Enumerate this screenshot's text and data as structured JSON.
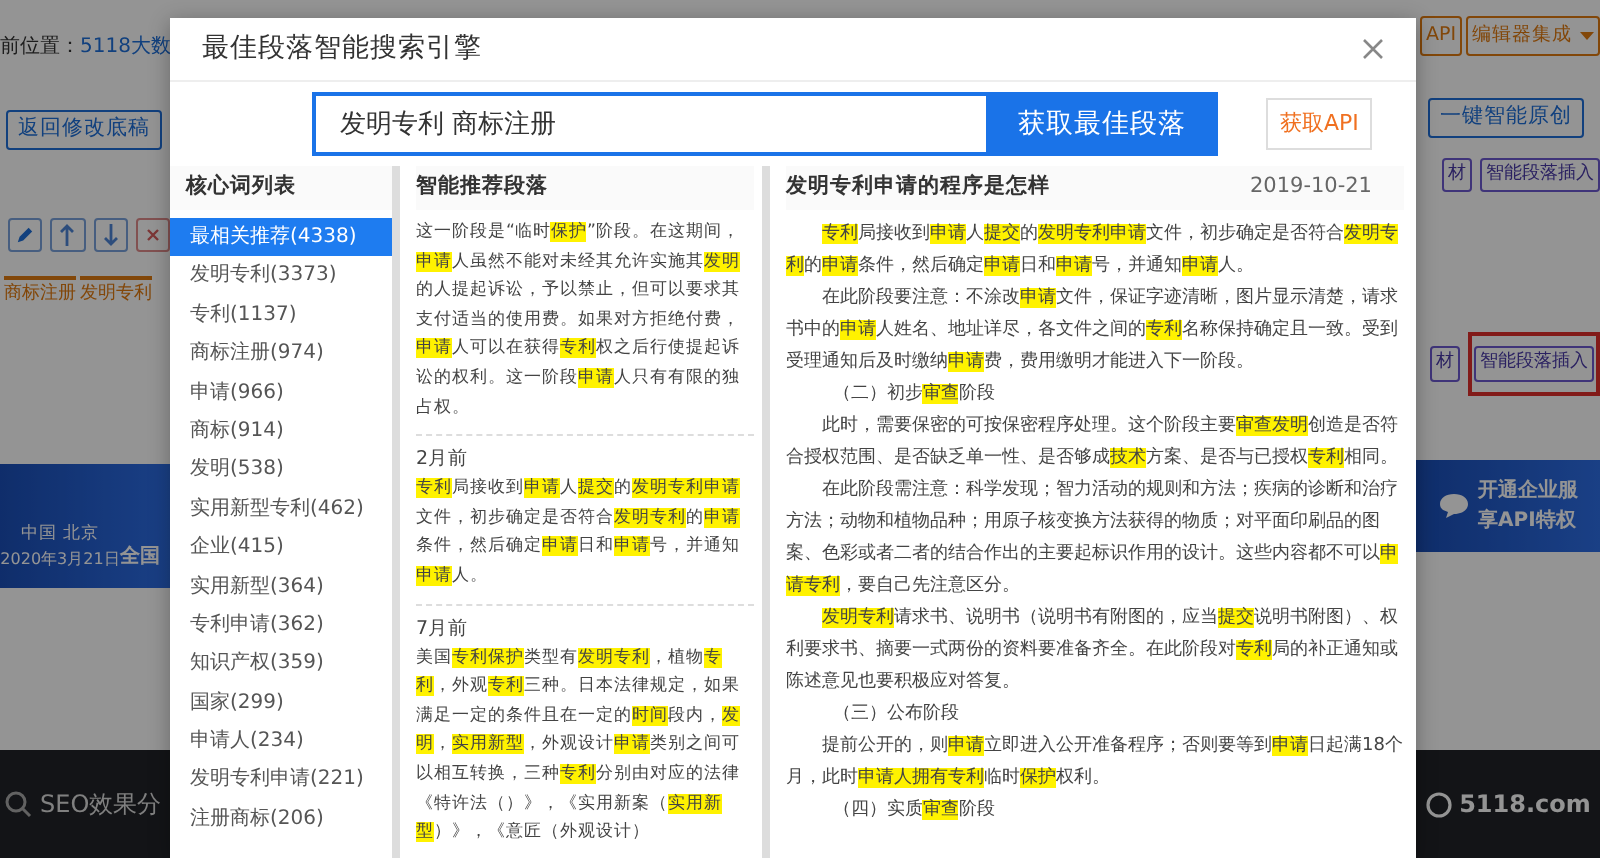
{
  "background": {
    "breadcrumb_label": "前位置：",
    "breadcrumb_link": "5118大数",
    "back_button": "返回修改底稿",
    "tags": [
      "商标注册",
      "发明专利"
    ],
    "banner": {
      "city": "中国 北京",
      "date": "2020年3月21日",
      "text_3": "全国"
    },
    "footer_search": "SEO效果分",
    "api_button": "API",
    "editor_menu": "编辑器集成",
    "rewrite_button": "一键智能原创",
    "toolbar_rows": [
      {
        "material": "材",
        "insert": "智能段落插入",
        "outlined": false
      },
      {
        "material": "材",
        "insert": "智能段落插入",
        "outlined": true
      }
    ],
    "promo": [
      "开通企业服",
      "享API特权"
    ],
    "logo": "5118.com"
  },
  "modal": {
    "title": "最佳段落智能搜索引擎",
    "search": {
      "value": "发明专利 商标注册",
      "button": "获取最佳段落"
    },
    "api_link": "获取API",
    "keywords": {
      "title": "核心词列表",
      "items": [
        {
          "label": "最相关推荐(4338)",
          "selected": true
        },
        {
          "label": "发明专利(3373)",
          "selected": false
        },
        {
          "label": "专利(1137)",
          "selected": false
        },
        {
          "label": "商标注册(974)",
          "selected": false
        },
        {
          "label": "申请(966)",
          "selected": false
        },
        {
          "label": "商标(914)",
          "selected": false
        },
        {
          "label": "发明(538)",
          "selected": false
        },
        {
          "label": "实用新型专利(462)",
          "selected": false
        },
        {
          "label": "企业(415)",
          "selected": false
        },
        {
          "label": "实用新型(364)",
          "selected": false
        },
        {
          "label": "专利申请(362)",
          "selected": false
        },
        {
          "label": "知识产权(359)",
          "selected": false
        },
        {
          "label": "国家(299)",
          "selected": false
        },
        {
          "label": "申请人(234)",
          "selected": false
        },
        {
          "label": "发明专利申请(221)",
          "selected": false
        },
        {
          "label": "注册商标(206)",
          "selected": false
        }
      ]
    },
    "recommended": {
      "title": "智能推荐段落",
      "blocks": [
        {
          "segments": [
            {
              "text": "这一阶段是“临时",
              "highlight": false
            },
            {
              "text": "保护",
              "highlight": true
            },
            {
              "text": "”阶段。在这期间，",
              "highlight": false
            },
            {
              "text": "申请",
              "highlight": true
            },
            {
              "text": "人虽然不能对未经其允许实施其",
              "highlight": false
            },
            {
              "text": "发明",
              "highlight": true
            },
            {
              "text": "的人提起诉讼，予以禁止，但可以要求其支付适当的使用费。如果对方拒绝付费，",
              "highlight": false
            },
            {
              "text": "申请",
              "highlight": true
            },
            {
              "text": "人可以在获得",
              "highlight": false
            },
            {
              "text": "专利",
              "highlight": true
            },
            {
              "text": "权之后行使提起诉讼的权利。这一阶段",
              "highlight": false
            },
            {
              "text": "申请",
              "highlight": true
            },
            {
              "text": "人只有有限的独占权。",
              "highlight": false
            }
          ]
        },
        {
          "age": "2月前",
          "segments": [
            {
              "text": "专利",
              "highlight": true
            },
            {
              "text": "局接收到",
              "highlight": false
            },
            {
              "text": "申请",
              "highlight": true
            },
            {
              "text": "人",
              "highlight": false
            },
            {
              "text": "提交",
              "highlight": true
            },
            {
              "text": "的",
              "highlight": false
            },
            {
              "text": "发明专利申请",
              "highlight": true
            },
            {
              "text": "文件，初步确定是否符合",
              "highlight": false
            },
            {
              "text": "发明专利",
              "highlight": true
            },
            {
              "text": "的",
              "highlight": false
            },
            {
              "text": "申请",
              "highlight": true
            },
            {
              "text": "条件，然后确定",
              "highlight": false
            },
            {
              "text": "申请",
              "highlight": true
            },
            {
              "text": "日和",
              "highlight": false
            },
            {
              "text": "申请",
              "highlight": true
            },
            {
              "text": "号，并通知",
              "highlight": false
            },
            {
              "text": "申请",
              "highlight": true
            },
            {
              "text": "人。",
              "highlight": false
            }
          ]
        },
        {
          "age": "7月前",
          "segments": [
            {
              "text": "美国",
              "highlight": false
            },
            {
              "text": "专利保护",
              "highlight": true
            },
            {
              "text": "类型有",
              "highlight": false
            },
            {
              "text": "发明专利",
              "highlight": true
            },
            {
              "text": "，植物",
              "highlight": false
            },
            {
              "text": "专利",
              "highlight": true
            },
            {
              "text": "，外观",
              "highlight": false
            },
            {
              "text": "专利",
              "highlight": true
            },
            {
              "text": "三种。日本法律规定，如果满足一定的条件且在一定的",
              "highlight": false
            },
            {
              "text": "时间",
              "highlight": true
            },
            {
              "text": "段内，",
              "highlight": false
            },
            {
              "text": "发明",
              "highlight": true
            },
            {
              "text": "，",
              "highlight": false
            },
            {
              "text": "实用新型",
              "highlight": true
            },
            {
              "text": "，外观设计",
              "highlight": false
            },
            {
              "text": "申请",
              "highlight": true
            },
            {
              "text": "类别之间可以相互转换，三种",
              "highlight": false
            },
            {
              "text": "专利",
              "highlight": true
            },
            {
              "text": "分别由对应的法律《特许法（）》，《实用新案（",
              "highlight": false
            },
            {
              "text": "实用新型",
              "highlight": true
            },
            {
              "text": "）》，《意匠（外观设计）",
              "highlight": false
            }
          ]
        }
      ]
    },
    "article": {
      "title": "发明专利申请的程序是怎样",
      "date": "2019-10-21",
      "paragraphs": [
        {
          "kind": "body",
          "segments": [
            {
              "text": "专利",
              "highlight": true
            },
            {
              "text": "局接收到",
              "highlight": false
            },
            {
              "text": "申请",
              "highlight": true
            },
            {
              "text": "人",
              "highlight": false
            },
            {
              "text": "提交",
              "highlight": true
            },
            {
              "text": "的",
              "highlight": false
            },
            {
              "text": "发明专利申请",
              "highlight": true
            },
            {
              "text": "文件，初步确定是否符合",
              "highlight": false
            },
            {
              "text": "发明专利",
              "highlight": true
            },
            {
              "text": "的",
              "highlight": false
            },
            {
              "text": "申请",
              "highlight": true
            },
            {
              "text": "条件，然后确定",
              "highlight": false
            },
            {
              "text": "申请",
              "highlight": true
            },
            {
              "text": "日和",
              "highlight": false
            },
            {
              "text": "申请",
              "highlight": true
            },
            {
              "text": "号，并通知",
              "highlight": false
            },
            {
              "text": "申请",
              "highlight": true
            },
            {
              "text": "人。",
              "highlight": false
            }
          ]
        },
        {
          "kind": "body",
          "segments": [
            {
              "text": "在此阶段要注意：不涂改",
              "highlight": false
            },
            {
              "text": "申请",
              "highlight": true
            },
            {
              "text": "文件，保证字迹清晰，图片显示清楚，请求书中的",
              "highlight": false
            },
            {
              "text": "申请",
              "highlight": true
            },
            {
              "text": "人姓名、地址详尽，各文件之间的",
              "highlight": false
            },
            {
              "text": "专利",
              "highlight": true
            },
            {
              "text": "名称保持确定且一致。受到受理通知后及时缴纳",
              "highlight": false
            },
            {
              "text": "申请",
              "highlight": true
            },
            {
              "text": "费，费用缴明才能进入下一阶段。",
              "highlight": false
            }
          ]
        },
        {
          "kind": "heading",
          "segments": [
            {
              "text": "（二）初步",
              "highlight": false
            },
            {
              "text": "审查",
              "highlight": true
            },
            {
              "text": "阶段",
              "highlight": false
            }
          ]
        },
        {
          "kind": "body",
          "segments": [
            {
              "text": "此时，需要保密的可按保密程序处理。这个阶段主要",
              "highlight": false
            },
            {
              "text": "审查发明",
              "highlight": true
            },
            {
              "text": "创造是否符合授权范围、是否缺乏单一性、是否够成",
              "highlight": false
            },
            {
              "text": "技术",
              "highlight": true
            },
            {
              "text": "方案、是否与已授权",
              "highlight": false
            },
            {
              "text": "专利",
              "highlight": true
            },
            {
              "text": "相同。",
              "highlight": false
            }
          ]
        },
        {
          "kind": "body",
          "segments": [
            {
              "text": "在此阶段需注意：科学发现；智力活动的规则和方法；疾病的诊断和治疗方法；动物和植物品种；用原子核变换方法获得的物质；对平面印刷品的图案、色彩或者二者的结合作出的主要起标识作用的设计。这些内容都不可以",
              "highlight": false
            },
            {
              "text": "申请专利",
              "highlight": true
            },
            {
              "text": "，要自己先注意区分。",
              "highlight": false
            }
          ]
        },
        {
          "kind": "body",
          "segments": [
            {
              "text": "发明专利",
              "highlight": true
            },
            {
              "text": "请求书、说明书（说明书有附图的，应当",
              "highlight": false
            },
            {
              "text": "提交",
              "highlight": true
            },
            {
              "text": "说明书附图）、权利要求书、摘要一式两份的资料要准备齐全。在此阶段对",
              "highlight": false
            },
            {
              "text": "专利",
              "highlight": true
            },
            {
              "text": "局的补正通知或陈述意见也要积极应对答复。",
              "highlight": false
            }
          ]
        },
        {
          "kind": "heading",
          "segments": [
            {
              "text": "（三）公布阶段",
              "highlight": false
            }
          ]
        },
        {
          "kind": "body",
          "segments": [
            {
              "text": "提前公开的，则",
              "highlight": false
            },
            {
              "text": "申请",
              "highlight": true
            },
            {
              "text": "立即进入公开准备程序；否则要等到",
              "highlight": false
            },
            {
              "text": "申请",
              "highlight": true
            },
            {
              "text": "日起满18个月，此时",
              "highlight": false
            },
            {
              "text": "申请人",
              "highlight": true
            },
            {
              "text": "拥有专利",
              "highlight": true
            },
            {
              "text": "临时",
              "highlight": false
            },
            {
              "text": "保护",
              "highlight": true
            },
            {
              "text": "权利。",
              "highlight": false
            }
          ]
        },
        {
          "kind": "heading",
          "segments": [
            {
              "text": "（四）实质",
              "highlight": false
            },
            {
              "text": "审查",
              "highlight": true
            },
            {
              "text": "阶段",
              "highlight": false
            }
          ]
        }
      ]
    }
  }
}
